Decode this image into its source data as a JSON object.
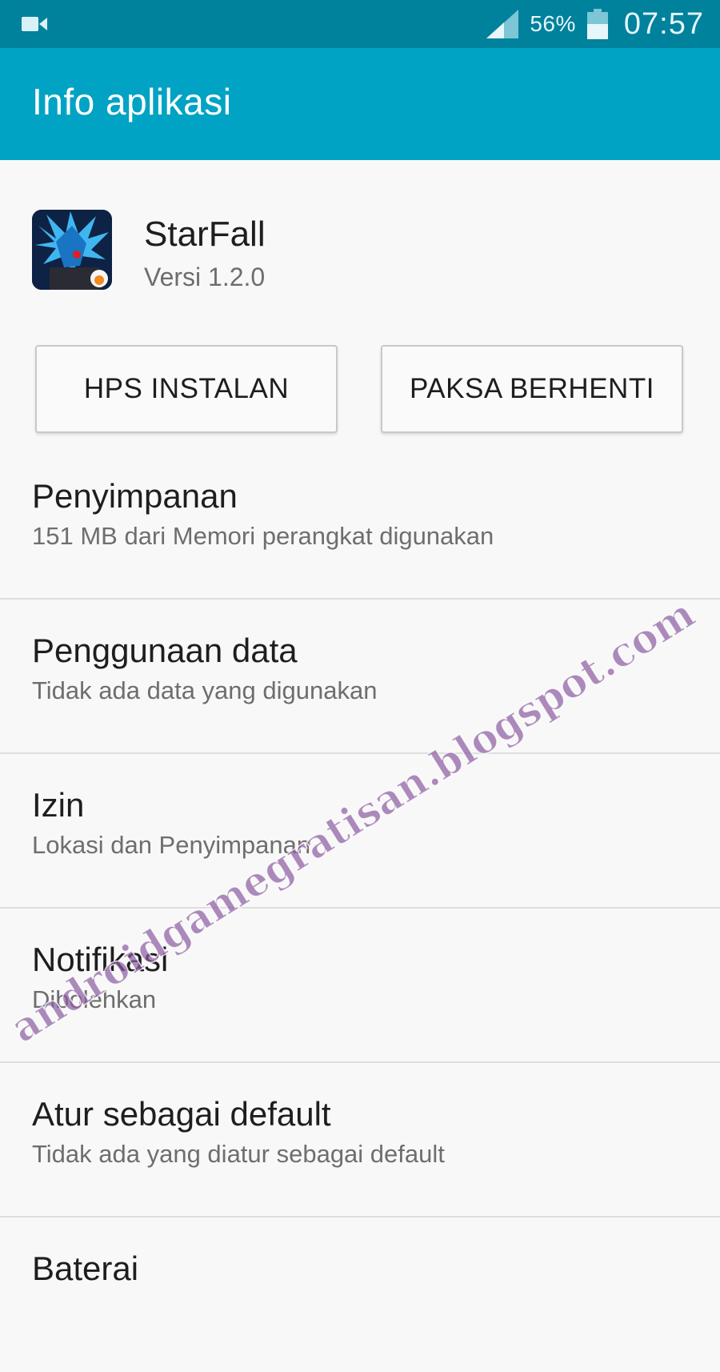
{
  "status_bar": {
    "battery_percent": "56%",
    "time": "07:57",
    "icons": [
      "video-recorder-icon",
      "signal-icon",
      "battery-icon"
    ]
  },
  "app_bar": {
    "title": "Info aplikasi"
  },
  "app": {
    "name": "StarFall",
    "version": "Versi 1.2.0",
    "icon": "starfall-app-icon"
  },
  "buttons": {
    "uninstall": "HPS INSTALAN",
    "force_stop": "PAKSA BERHENTI"
  },
  "settings": [
    {
      "title": "Penyimpanan",
      "subtitle": "151 MB dari Memori perangkat digunakan"
    },
    {
      "title": "Penggunaan data",
      "subtitle": "Tidak ada data yang digunakan"
    },
    {
      "title": "Izin",
      "subtitle": "Lokasi dan Penyimpanan"
    },
    {
      "title": "Notifikasi",
      "subtitle": "Dibolehkan"
    },
    {
      "title": "Atur sebagai default",
      "subtitle": "Tidak ada yang diatur sebagai default"
    },
    {
      "title": "Baterai",
      "subtitle": ""
    }
  ],
  "watermark": {
    "text": "androidgamegratisan.blogspot.com"
  },
  "colors": {
    "status_bar": "#00819c",
    "app_bar": "#00a3c3",
    "background": "#f8f8f8",
    "watermark": "#8a5aa0"
  }
}
